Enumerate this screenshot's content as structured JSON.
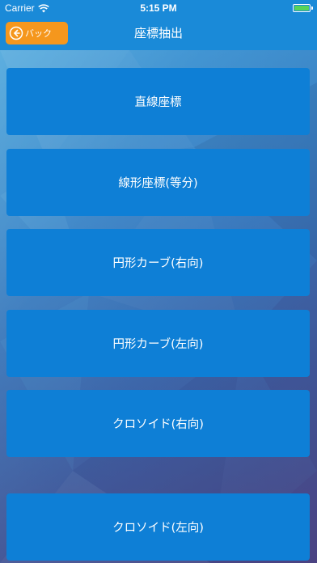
{
  "status_bar": {
    "carrier": "Carrier",
    "time": "5:15 PM",
    "battery_level": 1.0
  },
  "nav": {
    "back_label": "バック",
    "title": "座標抽出"
  },
  "menu": {
    "items": [
      {
        "label": "直線座標"
      },
      {
        "label": "線形座標(等分)"
      },
      {
        "label": "円形カーブ(右向)"
      },
      {
        "label": "円形カーブ(左向)"
      },
      {
        "label": "クロソイド(右向)"
      },
      {
        "label": "クロソイド(左向)"
      }
    ]
  },
  "colors": {
    "nav_bar": "#1a8ad8",
    "back_button": "#f5971d",
    "menu_button": "#0e7fd6",
    "text": "#ffffff"
  },
  "icons": {
    "back": "circle-arrow-left-icon",
    "wifi": "wifi-icon",
    "battery": "battery-icon"
  }
}
